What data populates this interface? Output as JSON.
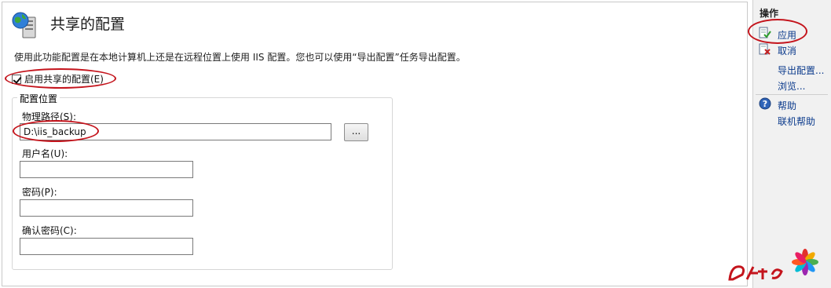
{
  "header": {
    "title": "共享的配置",
    "description": "使用此功能配置是在本地计算机上还是在远程位置上使用 IIS 配置。您也可以使用“导出配置”任务导出配置。"
  },
  "enable_shared": {
    "label": "启用共享的配置(E)",
    "checked": true
  },
  "config_location": {
    "title": "配置位置",
    "physical_path_label": "物理路径(S):",
    "physical_path_value": "D:\\iis_backup",
    "browse_label": "...",
    "username_label": "用户名(U):",
    "username_value": "",
    "password_label": "密码(P):",
    "password_value": "",
    "confirm_label": "确认密码(C):",
    "confirm_value": ""
  },
  "actions": {
    "title": "操作",
    "apply": "应用",
    "cancel": "取消",
    "export": "导出配置...",
    "browse": "浏览...",
    "help": "帮助",
    "online_help": "联机帮助"
  },
  "colors": {
    "annotation": "#c4141c",
    "link": "#0b3a8c",
    "pane_bg": "#f1f1f1"
  },
  "icons": {
    "page": "globe-server-icon",
    "apply": "apply-check-icon",
    "cancel": "cancel-x-icon",
    "help": "help-icon"
  }
}
